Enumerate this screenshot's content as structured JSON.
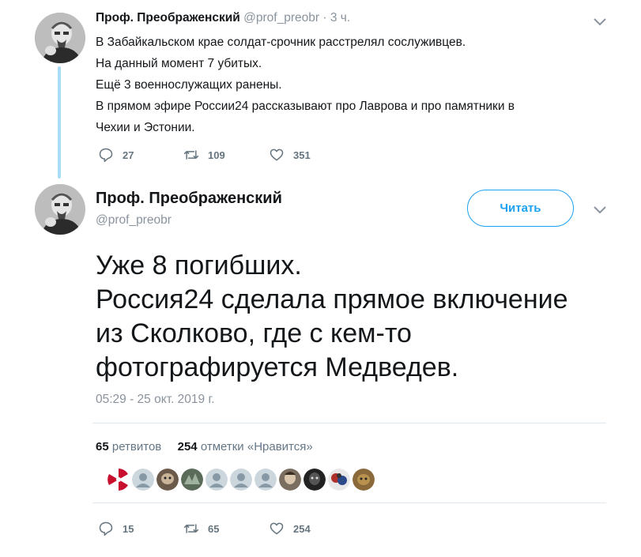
{
  "tweet1": {
    "display_name": "Проф. Преображенский",
    "handle": "@prof_preobr",
    "separator": "·",
    "time": "3 ч.",
    "lines": [
      "В Забайкальском крае солдат-срочник расстрелял сослуживцев.",
      "На данный момент 7 убитых.",
      "Ещё 3 военнослужащих ранены.",
      "В прямом эфире России24 рассказывают про Лаврова и про памятники в",
      "Чехии и Эстонии."
    ],
    "replies": "27",
    "retweets": "109",
    "likes": "351"
  },
  "tweet2": {
    "display_name": "Проф. Преображенский",
    "handle": "@prof_preobr",
    "follow_label": "Читать",
    "lines": [
      "Уже 8 погибших.",
      "Россия24 сделала прямое включение",
      "из Сколково, где с кем-то",
      "фотографируется Медведев."
    ],
    "timestamp": "05:29 - 25 окт. 2019 г.",
    "retweet_count": "65",
    "retweet_label": "ретвитов",
    "like_count": "254",
    "like_label": "отметки «Нравится»",
    "replies": "15",
    "retweets": "65",
    "likes": "254"
  },
  "colors": {
    "accent": "#1da1f2",
    "thread_line": "#aadcf5",
    "secondary_text": "#8a939d",
    "icon_gray": "#66757f"
  },
  "icons": [
    "reply-icon",
    "retweet-icon",
    "like-icon",
    "chevron-down-icon"
  ]
}
